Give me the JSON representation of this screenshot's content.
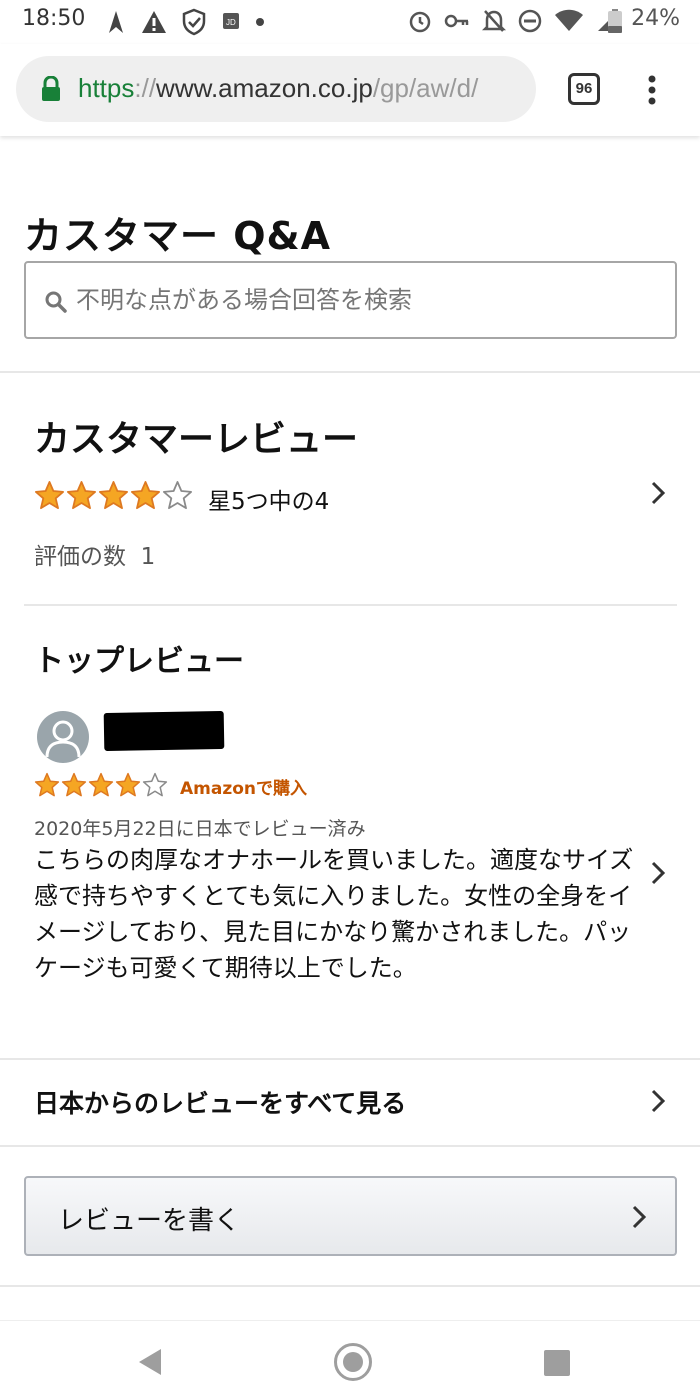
{
  "status_bar": {
    "time": "18:50",
    "battery": "24%",
    "icons_left": [
      "navigation-icon",
      "warning-icon",
      "shield-icon",
      "jd-app-icon",
      "dot-icon"
    ],
    "icons_right": [
      "alarm-icon",
      "key-icon",
      "notifications-off-icon",
      "do-not-disturb-icon",
      "wifi-icon",
      "signal-icon",
      "battery-icon"
    ]
  },
  "browser": {
    "url": {
      "scheme": "https",
      "sep": "://",
      "host": "www.amazon.co.jp",
      "path": "/gp/aw/d/"
    },
    "tab_count": "96"
  },
  "qa": {
    "title": "カスタマー Q&A",
    "search_placeholder": "不明な点がある場合回答を検索"
  },
  "reviews": {
    "title": "カスタマーレビュー",
    "rating_value": 4,
    "rating_max": 5,
    "rating_text": "星5つ中の4",
    "count_label": "評価の数",
    "count": "1"
  },
  "top_review": {
    "title": "トップレビュー",
    "reviewer_name_redacted": true,
    "rating_value": 4,
    "verified": "Amazonで購入",
    "date": "2020年5月22日に日本でレビュー済み",
    "body": "こちらの肉厚なオナホールを買いました。適度なサイズ感で持ちやすくとても気に入りました。女性の全身をイメージしており、見た目にかなり驚かされました。パッケージも可愛くて期待以上でした。"
  },
  "see_all": "日本からのレビューをすべて見る",
  "write_review": "レビューを書く",
  "colors": {
    "star": "#f5a623",
    "star_stroke": "#de7921",
    "url_green": "#188038",
    "verified_orange": "#c45500",
    "avatar_grey": "#9aa5ab"
  }
}
